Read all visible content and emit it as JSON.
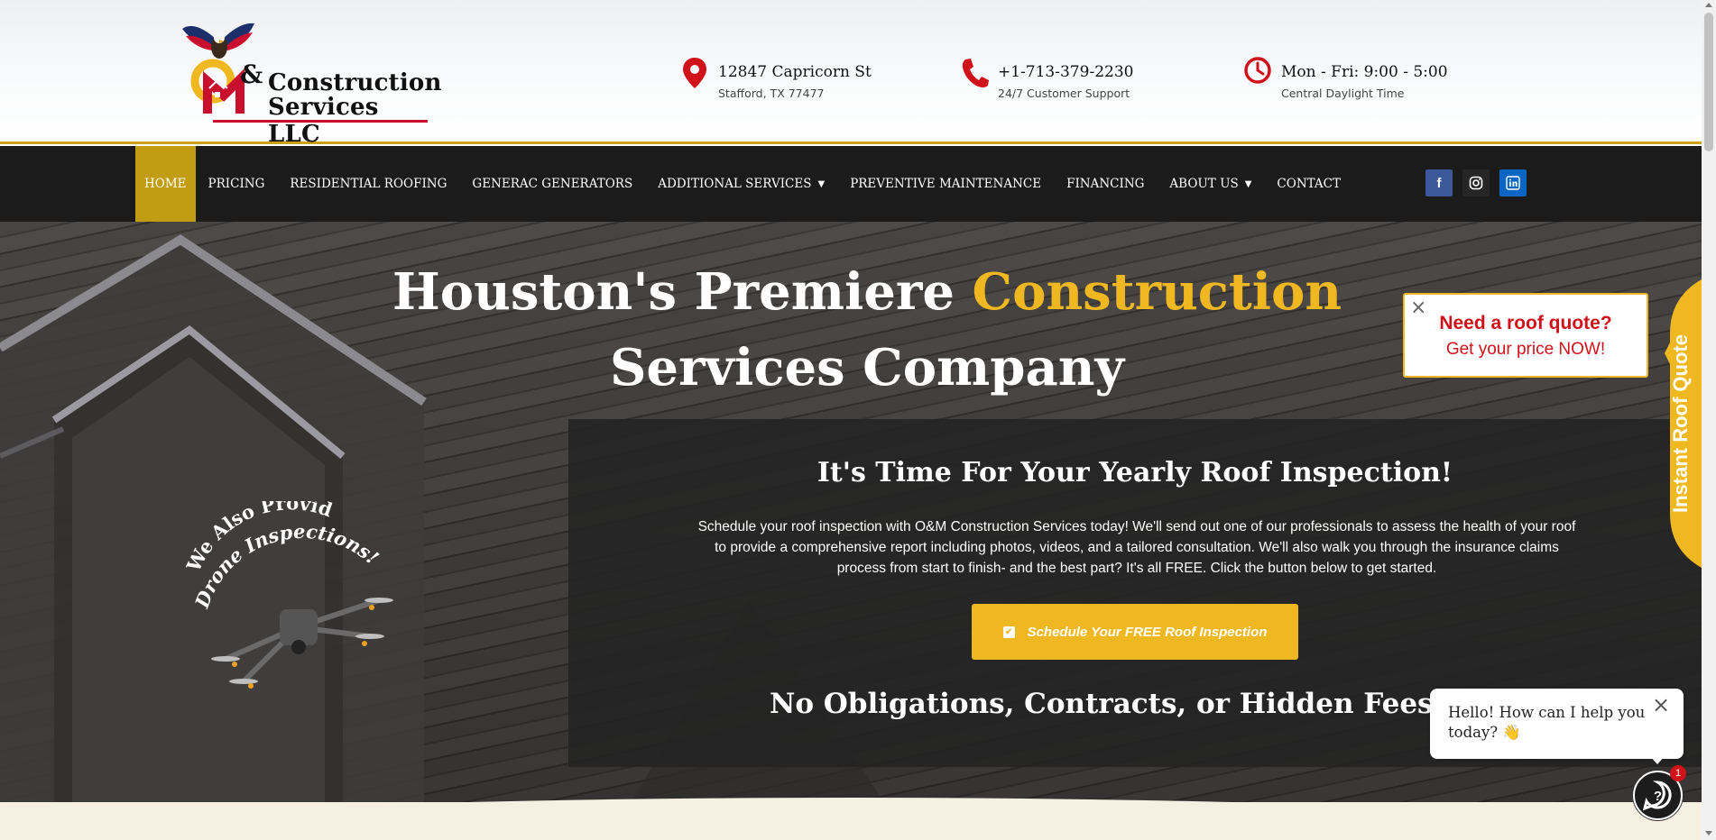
{
  "logo": {
    "amp": "&",
    "line1": "Construction",
    "line2": "Services LLC"
  },
  "contact": {
    "address": {
      "line1": "12847 Capricorn St",
      "line2": "Stafford, TX 77477",
      "icon": "location-pin-icon"
    },
    "phone": {
      "line1": "+1-713-379-2230",
      "line2": "24/7 Customer Support",
      "icon": "phone-icon"
    },
    "hours": {
      "line1": "Mon - Fri: 9:00 - 5:00",
      "line2": "Central Daylight Time",
      "icon": "clock-icon"
    }
  },
  "nav": {
    "items": [
      {
        "label": "Home",
        "active": true
      },
      {
        "label": "Pricing"
      },
      {
        "label": "Residential Roofing"
      },
      {
        "label": "Generac Generators"
      },
      {
        "label": "Additional Services",
        "dropdown": true
      },
      {
        "label": "Preventive Maintenance"
      },
      {
        "label": "Financing"
      },
      {
        "label": "About Us",
        "dropdown": true
      },
      {
        "label": "Contact"
      }
    ],
    "social": [
      "facebook-icon",
      "instagram-icon",
      "linkedin-icon"
    ]
  },
  "hero": {
    "title_part1": "Houston's Premiere ",
    "title_highlight": "Construction",
    "title_part2": "Services Company",
    "panel_title": "It's Time For Your Yearly Roof Inspection!",
    "panel_body": "Schedule your roof inspection with O&M Construction Services today! We'll send out one of our professionals to assess the health of your roof to provide a comprehensive report including photos, videos, and a tailored consultation. We'll also walk you through the insurance claims process from start to finish- and the best part? It's all FREE. Click the button below to get started.",
    "cta_label": "Schedule Your FREE Roof Inspection",
    "guarantee": "No Obligations, Contracts, or Hidden Fees. Guaran",
    "drone_line1": "We Also Provide",
    "drone_line2": "Drone Inspections!"
  },
  "quote_popup": {
    "line1": "Need a roof quote?",
    "line2": "Get your price NOW!",
    "tab_label": "Instant Roof Quote",
    "close": "×"
  },
  "chat": {
    "message": "Hello! How can I help you today? 👋",
    "close": "×",
    "badge": "1"
  },
  "colors": {
    "accent": "#f0b820",
    "nav_active": "#c29c12",
    "brand_red": "#d0121b",
    "nav_bg": "#1b1b1b"
  }
}
